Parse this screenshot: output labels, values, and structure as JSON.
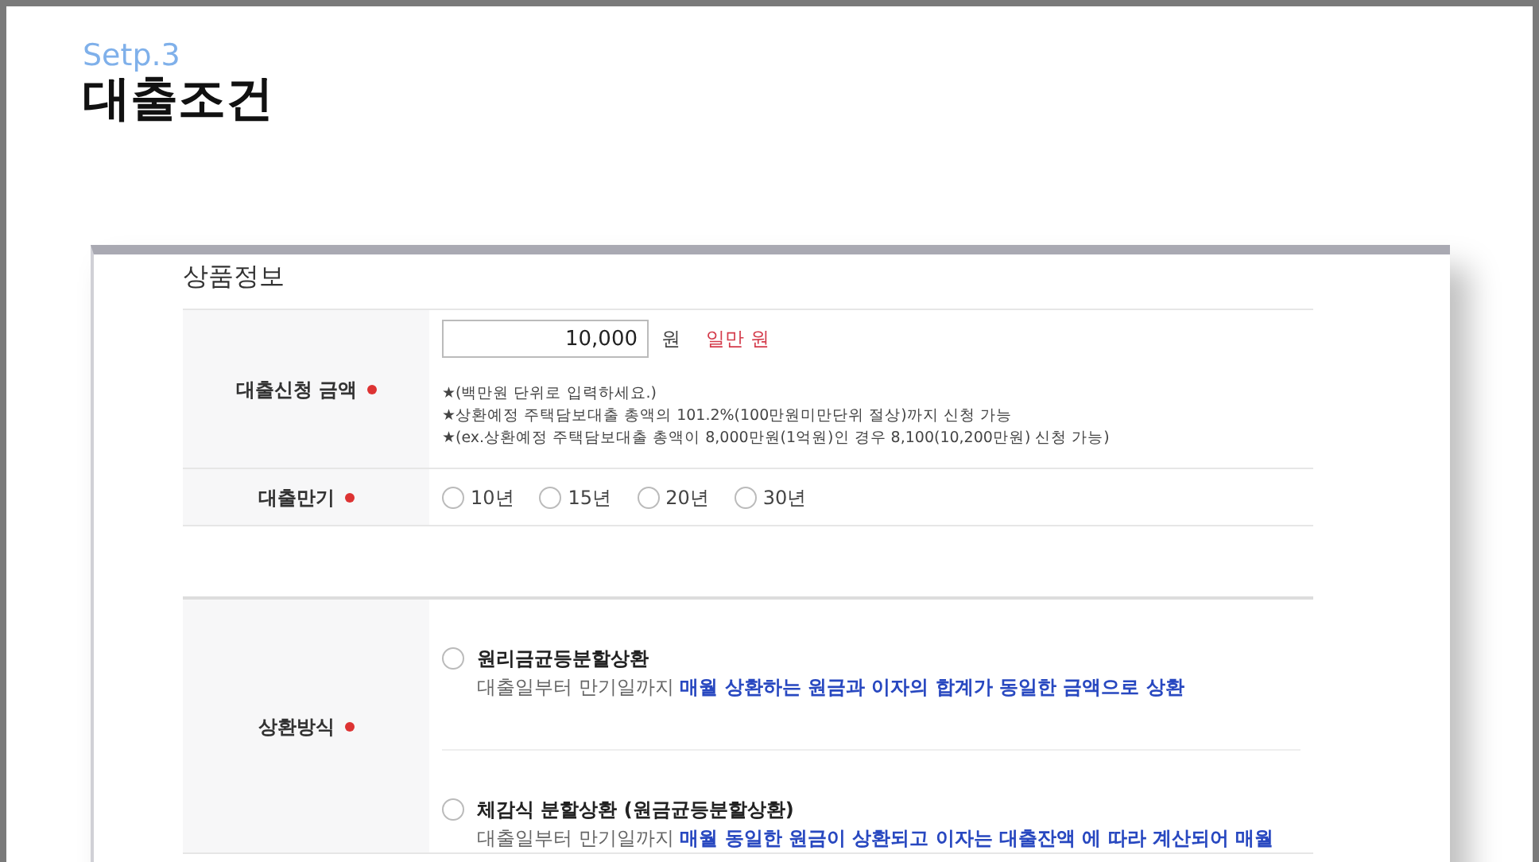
{
  "step": "Setp.3",
  "title": "대출조건",
  "section_title": "상품정보",
  "amount": {
    "label": "대출신청 금액",
    "required": true,
    "value": "10,000",
    "unit": "원",
    "in_words": "일만 원",
    "notes": [
      "★(백만원 단위로 입력하세요.)",
      "★상환예정 주택담보대출 총액의 101.2%(100만원미만단위 절상)까지 신청 가능",
      "★(ex.상환예정 주택담보대출 총액이 8,000만원(1억원)인 경우 8,100(10,200만원) 신청 가능)"
    ]
  },
  "term": {
    "label": "대출만기",
    "required": true,
    "options": [
      {
        "label": "10년",
        "selected": false
      },
      {
        "label": "15년",
        "selected": false
      },
      {
        "label": "20년",
        "selected": false
      },
      {
        "label": "30년",
        "selected": false
      }
    ]
  },
  "repayment": {
    "label": "상환방식",
    "required": true,
    "options": [
      {
        "title": "원리금균등분할상환",
        "selected": false,
        "description": "대출일부터 만기일까지 **매월 상환하는 원금과 이자의 합계가 동일한 금액으로 상환**"
      },
      {
        "title": "체감식 분할상환 (원금균등분할상환)",
        "selected": false,
        "description": "대출일부터 만기일까지 **매월 동일한 원금이 상환되고 이자는 대출잔액 에 따라 계산되어 매월**"
      }
    ]
  }
}
